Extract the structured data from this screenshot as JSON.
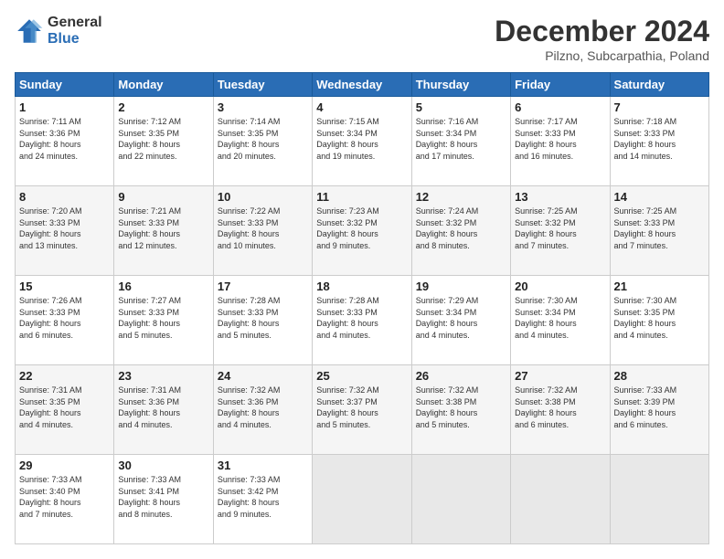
{
  "logo": {
    "general": "General",
    "blue": "Blue"
  },
  "header": {
    "title": "December 2024",
    "subtitle": "Pilzno, Subcarpathia, Poland"
  },
  "weekdays": [
    "Sunday",
    "Monday",
    "Tuesday",
    "Wednesday",
    "Thursday",
    "Friday",
    "Saturday"
  ],
  "weeks": [
    [
      {
        "day": "1",
        "sunrise": "7:11 AM",
        "sunset": "3:36 PM",
        "daylight_hours": "8",
        "daylight_mins": "24"
      },
      {
        "day": "2",
        "sunrise": "7:12 AM",
        "sunset": "3:35 PM",
        "daylight_hours": "8",
        "daylight_mins": "22"
      },
      {
        "day": "3",
        "sunrise": "7:14 AM",
        "sunset": "3:35 PM",
        "daylight_hours": "8",
        "daylight_mins": "20"
      },
      {
        "day": "4",
        "sunrise": "7:15 AM",
        "sunset": "3:34 PM",
        "daylight_hours": "8",
        "daylight_mins": "19"
      },
      {
        "day": "5",
        "sunrise": "7:16 AM",
        "sunset": "3:34 PM",
        "daylight_hours": "8",
        "daylight_mins": "17"
      },
      {
        "day": "6",
        "sunrise": "7:17 AM",
        "sunset": "3:33 PM",
        "daylight_hours": "8",
        "daylight_mins": "16"
      },
      {
        "day": "7",
        "sunrise": "7:18 AM",
        "sunset": "3:33 PM",
        "daylight_hours": "8",
        "daylight_mins": "14"
      }
    ],
    [
      {
        "day": "8",
        "sunrise": "7:20 AM",
        "sunset": "3:33 PM",
        "daylight_hours": "8",
        "daylight_mins": "13"
      },
      {
        "day": "9",
        "sunrise": "7:21 AM",
        "sunset": "3:33 PM",
        "daylight_hours": "8",
        "daylight_mins": "12"
      },
      {
        "day": "10",
        "sunrise": "7:22 AM",
        "sunset": "3:33 PM",
        "daylight_hours": "8",
        "daylight_mins": "10"
      },
      {
        "day": "11",
        "sunrise": "7:23 AM",
        "sunset": "3:32 PM",
        "daylight_hours": "8",
        "daylight_mins": "9"
      },
      {
        "day": "12",
        "sunrise": "7:24 AM",
        "sunset": "3:32 PM",
        "daylight_hours": "8",
        "daylight_mins": "8"
      },
      {
        "day": "13",
        "sunrise": "7:25 AM",
        "sunset": "3:32 PM",
        "daylight_hours": "8",
        "daylight_mins": "7"
      },
      {
        "day": "14",
        "sunrise": "7:25 AM",
        "sunset": "3:33 PM",
        "daylight_hours": "8",
        "daylight_mins": "7"
      }
    ],
    [
      {
        "day": "15",
        "sunrise": "7:26 AM",
        "sunset": "3:33 PM",
        "daylight_hours": "8",
        "daylight_mins": "6"
      },
      {
        "day": "16",
        "sunrise": "7:27 AM",
        "sunset": "3:33 PM",
        "daylight_hours": "8",
        "daylight_mins": "5"
      },
      {
        "day": "17",
        "sunrise": "7:28 AM",
        "sunset": "3:33 PM",
        "daylight_hours": "8",
        "daylight_mins": "5"
      },
      {
        "day": "18",
        "sunrise": "7:28 AM",
        "sunset": "3:33 PM",
        "daylight_hours": "8",
        "daylight_mins": "4"
      },
      {
        "day": "19",
        "sunrise": "7:29 AM",
        "sunset": "3:34 PM",
        "daylight_hours": "8",
        "daylight_mins": "4"
      },
      {
        "day": "20",
        "sunrise": "7:30 AM",
        "sunset": "3:34 PM",
        "daylight_hours": "8",
        "daylight_mins": "4"
      },
      {
        "day": "21",
        "sunrise": "7:30 AM",
        "sunset": "3:35 PM",
        "daylight_hours": "8",
        "daylight_mins": "4"
      }
    ],
    [
      {
        "day": "22",
        "sunrise": "7:31 AM",
        "sunset": "3:35 PM",
        "daylight_hours": "8",
        "daylight_mins": "4"
      },
      {
        "day": "23",
        "sunrise": "7:31 AM",
        "sunset": "3:36 PM",
        "daylight_hours": "8",
        "daylight_mins": "4"
      },
      {
        "day": "24",
        "sunrise": "7:32 AM",
        "sunset": "3:36 PM",
        "daylight_hours": "8",
        "daylight_mins": "4"
      },
      {
        "day": "25",
        "sunrise": "7:32 AM",
        "sunset": "3:37 PM",
        "daylight_hours": "8",
        "daylight_mins": "5"
      },
      {
        "day": "26",
        "sunrise": "7:32 AM",
        "sunset": "3:38 PM",
        "daylight_hours": "8",
        "daylight_mins": "5"
      },
      {
        "day": "27",
        "sunrise": "7:32 AM",
        "sunset": "3:38 PM",
        "daylight_hours": "8",
        "daylight_mins": "6"
      },
      {
        "day": "28",
        "sunrise": "7:33 AM",
        "sunset": "3:39 PM",
        "daylight_hours": "8",
        "daylight_mins": "6"
      }
    ],
    [
      {
        "day": "29",
        "sunrise": "7:33 AM",
        "sunset": "3:40 PM",
        "daylight_hours": "8",
        "daylight_mins": "7"
      },
      {
        "day": "30",
        "sunrise": "7:33 AM",
        "sunset": "3:41 PM",
        "daylight_hours": "8",
        "daylight_mins": "8"
      },
      {
        "day": "31",
        "sunrise": "7:33 AM",
        "sunset": "3:42 PM",
        "daylight_hours": "8",
        "daylight_mins": "9"
      },
      null,
      null,
      null,
      null
    ]
  ]
}
